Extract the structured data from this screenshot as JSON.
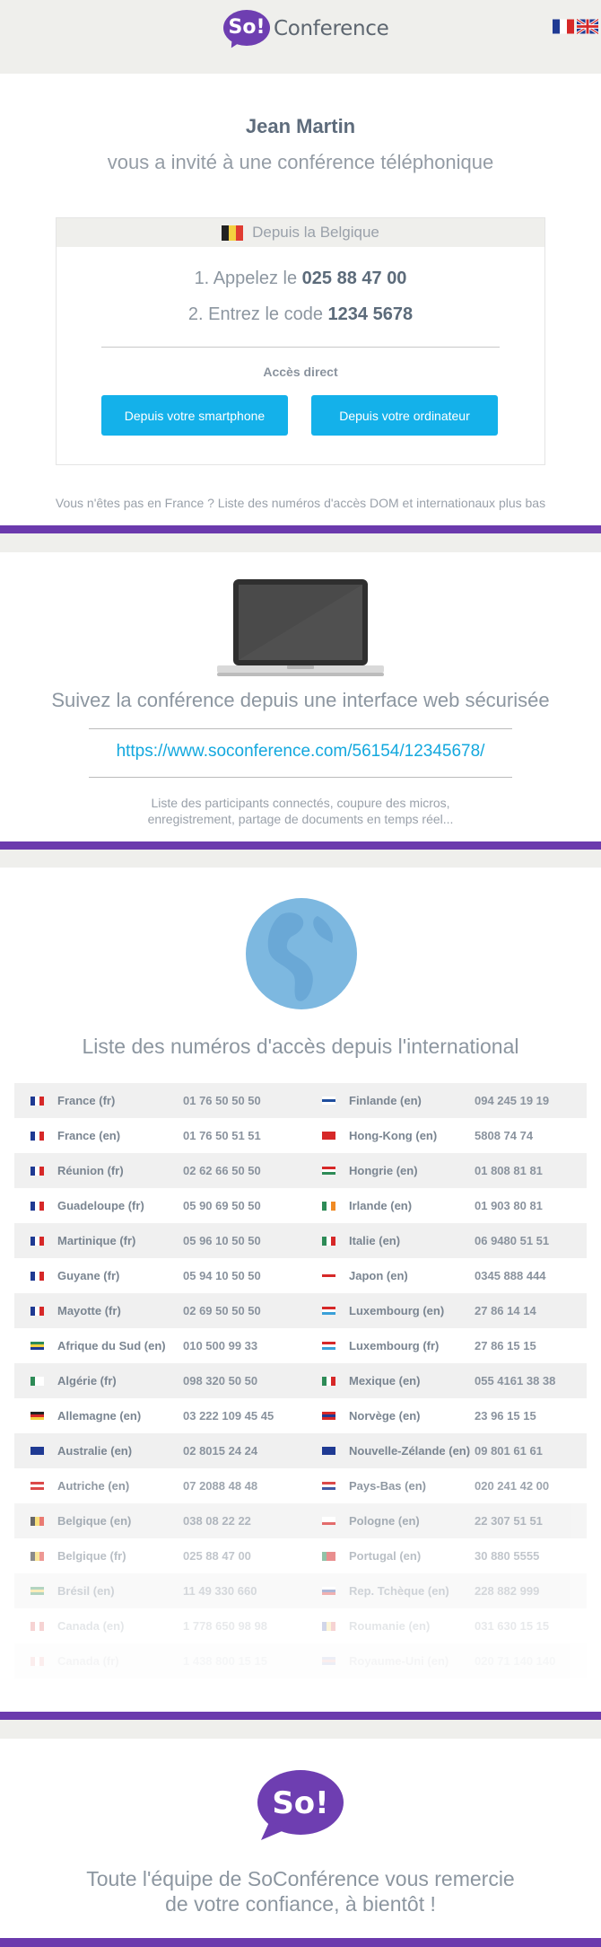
{
  "header": {
    "logo_badge": "So!",
    "logo_text": "Conference",
    "languages": [
      {
        "code": "fr",
        "icon": "flag-france-icon"
      },
      {
        "code": "en",
        "icon": "flag-uk-icon"
      }
    ]
  },
  "invite": {
    "host_name": "Jean Martin",
    "message": "vous a invité à une conférence téléphonique",
    "box_title": "Depuis la Belgique",
    "step1_prefix": "1. Appelez le ",
    "step1_number": "025 88 47 00",
    "step2_prefix": "2. Entrez le code ",
    "step2_code": "1234 5678",
    "direct_label": "Accès direct",
    "btn_smartphone": "Depuis votre smartphone",
    "btn_computer": "Depuis votre ordinateur",
    "note": "Vous n'êtes pas en France ? Liste des numéros d'accès DOM et internationaux plus bas"
  },
  "web": {
    "title": "Suivez la conférence depuis une interface web sécurisée",
    "link": "https://www.soconference.com/56154/12345678/",
    "desc_line1": "Liste des participants connectés, coupure des micros,",
    "desc_line2": "enregistrement, partage de documents en temps réel..."
  },
  "international": {
    "title": "Liste des numéros d'accès depuis l'international",
    "rows": [
      {
        "left": {
          "name": "France (fr)",
          "number": "01 76 50 50 50",
          "flag": "fr"
        },
        "right": {
          "name": "Finlande (en)",
          "number": "094 245 19 19",
          "flag": "fi"
        }
      },
      {
        "left": {
          "name": "France (en)",
          "number": "01 76 50 51 51",
          "flag": "fr"
        },
        "right": {
          "name": "Hong-Kong (en)",
          "number": "5808 74 74",
          "flag": "hk"
        }
      },
      {
        "left": {
          "name": "Réunion (fr)",
          "number": "02 62 66 50 50",
          "flag": "fr"
        },
        "right": {
          "name": "Hongrie (en)",
          "number": "01 808 81 81",
          "flag": "hu"
        }
      },
      {
        "left": {
          "name": "Guadeloupe (fr)",
          "number": "05 90 69 50 50",
          "flag": "fr"
        },
        "right": {
          "name": "Irlande (en)",
          "number": "01 903 80 81",
          "flag": "ie"
        }
      },
      {
        "left": {
          "name": "Martinique (fr)",
          "number": "05 96 10 50 50",
          "flag": "fr"
        },
        "right": {
          "name": "Italie (en)",
          "number": "06 9480 51 51",
          "flag": "it"
        }
      },
      {
        "left": {
          "name": "Guyane (fr)",
          "number": "05 94 10 50 50",
          "flag": "fr"
        },
        "right": {
          "name": "Japon (en)",
          "number": "0345 888 444",
          "flag": "jp"
        }
      },
      {
        "left": {
          "name": "Mayotte (fr)",
          "number": "02 69 50 50 50",
          "flag": "fr"
        },
        "right": {
          "name": "Luxembourg (en)",
          "number": "27 86 14 14",
          "flag": "lu"
        }
      },
      {
        "left": {
          "name": "Afrique du Sud (en)",
          "number": "010 500 99 33",
          "flag": "za"
        },
        "right": {
          "name": "Luxembourg (fr)",
          "number": "27 86 15 15",
          "flag": "lu"
        }
      },
      {
        "left": {
          "name": "Algérie (fr)",
          "number": "098 320 50 50",
          "flag": "dz"
        },
        "right": {
          "name": "Mexique (en)",
          "number": "055 4161 38 38",
          "flag": "mx"
        }
      },
      {
        "left": {
          "name": "Allemagne (en)",
          "number": "03 222 109 45 45",
          "flag": "de"
        },
        "right": {
          "name": "Norvège (en)",
          "number": "23 96 15 15",
          "flag": "no"
        }
      },
      {
        "left": {
          "name": "Australie (en)",
          "number": "02 8015 24 24",
          "flag": "au"
        },
        "right": {
          "name": "Nouvelle-Zélande (en)",
          "number": "09 801 61 61",
          "flag": "nz"
        }
      },
      {
        "left": {
          "name": "Autriche (en)",
          "number": "07 2088 48 48",
          "flag": "at"
        },
        "right": {
          "name": "Pays-Bas (en)",
          "number": "020 241 42 00",
          "flag": "nl"
        }
      },
      {
        "left": {
          "name": "Belgique (en)",
          "number": "038 08 22 22",
          "flag": "be"
        },
        "right": {
          "name": "Pologne (en)",
          "number": "22 307 51 51",
          "flag": "pl"
        }
      },
      {
        "left": {
          "name": "Belgique (fr)",
          "number": "025 88 47 00",
          "flag": "be"
        },
        "right": {
          "name": "Portugal (en)",
          "number": "30 880 5555",
          "flag": "pt"
        }
      },
      {
        "left": {
          "name": "Brésil (en)",
          "number": "11 49 330 660",
          "flag": "br"
        },
        "right": {
          "name": "Rep. Tchèque (en)",
          "number": "228 882 999",
          "flag": "cz"
        }
      },
      {
        "left": {
          "name": "Canada (en)",
          "number": "1 778 650 98 98",
          "flag": "ca"
        },
        "right": {
          "name": "Roumanie (en)",
          "number": "031 630 15 15",
          "flag": "ro"
        }
      },
      {
        "left": {
          "name": "Canada (fr)",
          "number": "1 438 800 15 15",
          "flag": "ca"
        },
        "right": {
          "name": "Royaume-Uni (en)",
          "number": "020 71 140 140",
          "flag": "gb"
        }
      }
    ]
  },
  "footer": {
    "badge": "So!",
    "thanks_line1": "Toute l'équipe de SoConférence vous remercie",
    "thanks_line2": "de votre confiance, à bientôt !"
  },
  "colors": {
    "brand_purple": "#6b3aad",
    "button_blue": "#14b1ea",
    "link_blue": "#13a8de"
  }
}
